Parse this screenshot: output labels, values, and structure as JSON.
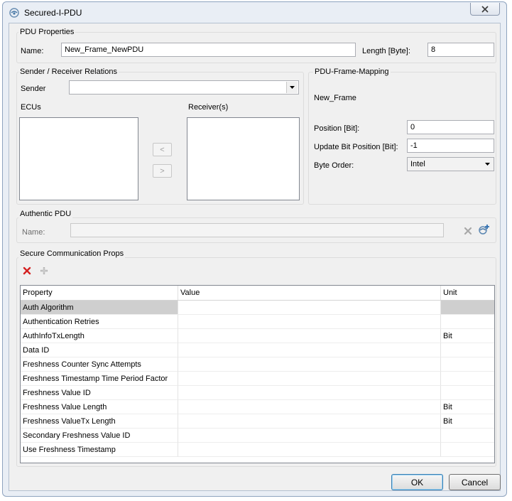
{
  "window": {
    "title": "Secured-I-PDU"
  },
  "pdu_properties": {
    "group_label": "PDU Properties",
    "name_label": "Name:",
    "name_value": "New_Frame_NewPDU",
    "length_label": "Length [Byte]:",
    "length_value": "8"
  },
  "sender_receiver": {
    "group_label": "Sender / Receiver Relations",
    "sender_label": "Sender",
    "sender_value": "",
    "ecus_label": "ECUs",
    "receivers_label": "Receiver(s)",
    "move_left_label": "<",
    "move_right_label": ">"
  },
  "frame_mapping": {
    "group_label": "PDU-Frame-Mapping",
    "frame_name": "New_Frame",
    "position_label": "Position [Bit]:",
    "position_value": "0",
    "update_bit_label": "Update Bit Position [Bit]:",
    "update_bit_value": "-1",
    "byte_order_label": "Byte Order:",
    "byte_order_value": "Intel"
  },
  "authentic_pdu": {
    "group_label": "Authentic PDU",
    "name_label": "Name:",
    "name_value": ""
  },
  "secure_comm": {
    "group_label": "Secure Communication Props",
    "columns": [
      "Property",
      "Value",
      "Unit"
    ],
    "rows": [
      {
        "property": "Auth Algorithm",
        "value": "",
        "unit": ""
      },
      {
        "property": "Authentication Retries",
        "value": "",
        "unit": ""
      },
      {
        "property": "AuthInfoTxLength",
        "value": "",
        "unit": "Bit"
      },
      {
        "property": "Data ID",
        "value": "",
        "unit": ""
      },
      {
        "property": "Freshness Counter Sync Attempts",
        "value": "",
        "unit": ""
      },
      {
        "property": "Freshness Timestamp Time Period Factor",
        "value": "",
        "unit": ""
      },
      {
        "property": "Freshness Value ID",
        "value": "",
        "unit": ""
      },
      {
        "property": "Freshness Value Length",
        "value": "",
        "unit": "Bit"
      },
      {
        "property": "Freshness ValueTx Length",
        "value": "",
        "unit": "Bit"
      },
      {
        "property": "Secondary Freshness Value ID",
        "value": "",
        "unit": ""
      },
      {
        "property": "Use Freshness Timestamp",
        "value": "",
        "unit": ""
      }
    ]
  },
  "buttons": {
    "ok": "OK",
    "cancel": "Cancel"
  },
  "colors": {
    "accent": "#3c7fb1",
    "delete_red": "#d42020",
    "selection_gray": "#cfcfcf"
  }
}
